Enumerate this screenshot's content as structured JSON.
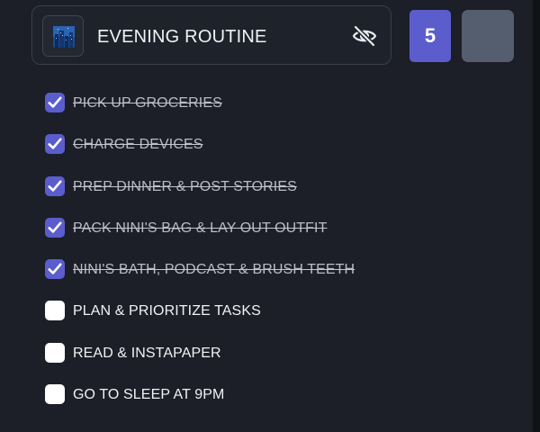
{
  "routine": {
    "title": "EVENING ROUTINE",
    "thumbnail_icon": "city-night-icon",
    "visibility_icon": "eye-off-icon"
  },
  "badge": {
    "count": "5"
  },
  "colors": {
    "background": "#1c1f27",
    "accent": "#5b5dcc",
    "grey_box": "#555e6e"
  },
  "tasks": [
    {
      "label": "PICK UP GROCERIES",
      "checked": true
    },
    {
      "label": "CHARGE DEVICES",
      "checked": true
    },
    {
      "label": "PREP DINNER & POST STORIES",
      "checked": true
    },
    {
      "label": "PACK NINI'S BAG & LAY OUT OUTFIT",
      "checked": true
    },
    {
      "label": "NINI'S BATH, PODCAST & BRUSH TEETH",
      "checked": true
    },
    {
      "label": "PLAN & PRIORITIZE TASKS",
      "checked": false
    },
    {
      "label": "READ & INSTAPAPER",
      "checked": false
    },
    {
      "label": "GO TO SLEEP AT 9PM",
      "checked": false
    }
  ]
}
